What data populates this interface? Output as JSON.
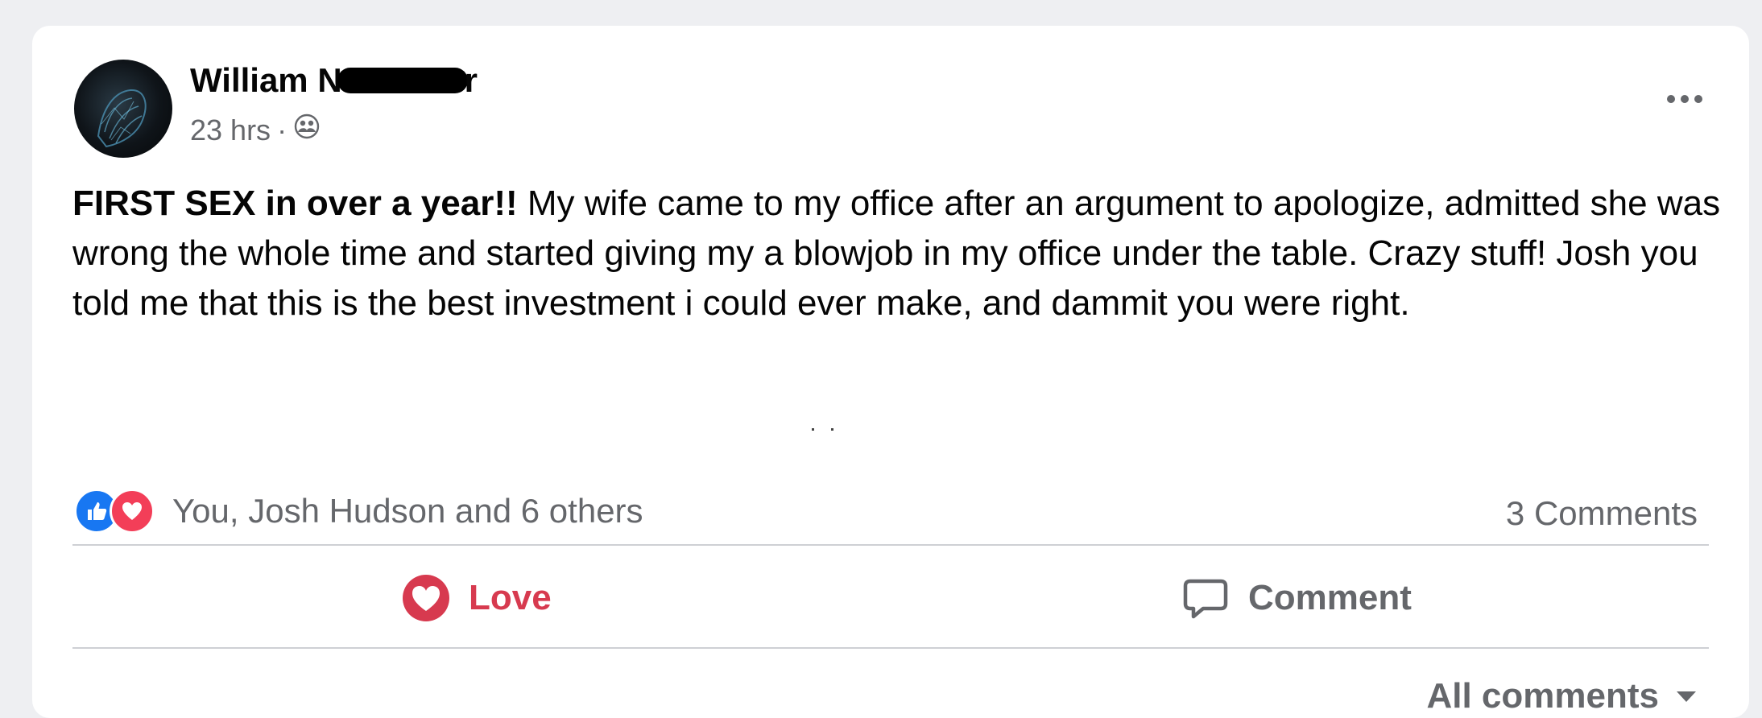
{
  "post": {
    "author_visible_start": "William N",
    "author_visible_end": "r",
    "timestamp": "23 hrs",
    "separator": "·",
    "privacy_icon": "friends-icon",
    "more_icon": "more-options-icon",
    "text_bold": "FIRST SEX in over a year!!",
    "text_rest": " My wife came to my office after an argument to apologize, admitted she was wrong the whole time and started giving my a blowjob in my office under the table. Crazy stuff! Josh you told me that this is the best investment i could ever make, and dammit you were right."
  },
  "reactions": {
    "icons": [
      "like-icon",
      "love-icon"
    ],
    "summary": "You, Josh Hudson and 6 others",
    "comments_count": "3 Comments"
  },
  "actions": {
    "love_label": "Love",
    "comment_label": "Comment"
  },
  "comments_filter": {
    "label": "All comments"
  },
  "colors": {
    "love": "#d73a4f",
    "like": "#1877f2",
    "secondary_text": "#65676b"
  }
}
